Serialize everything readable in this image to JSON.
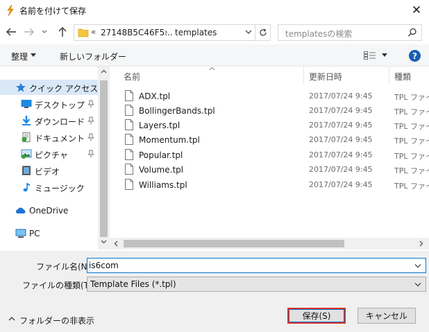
{
  "window": {
    "title": "名前を付けて保存",
    "close_label": "✕"
  },
  "address": {
    "prefix": "«",
    "parent": "27148B5C46F5...",
    "separator": "›",
    "current": "templates"
  },
  "search": {
    "placeholder": "templatesの検索"
  },
  "toolbar": {
    "organize_label": "整理",
    "new_folder_label": "新しいフォルダー"
  },
  "nav": {
    "items": [
      {
        "label": "クイック アクセス",
        "icon": "star-icon",
        "pinned": false
      },
      {
        "label": "デスクトップ",
        "icon": "desktop-icon",
        "pinned": true
      },
      {
        "label": "ダウンロード",
        "icon": "download-icon",
        "pinned": true
      },
      {
        "label": "ドキュメント",
        "icon": "documents-icon",
        "pinned": true
      },
      {
        "label": "ピクチャ",
        "icon": "pictures-icon",
        "pinned": true
      },
      {
        "label": "ビデオ",
        "icon": "video-icon",
        "pinned": false
      },
      {
        "label": "ミュージック",
        "icon": "music-icon",
        "pinned": false
      },
      {
        "label": "OneDrive",
        "icon": "onedrive-icon",
        "pinned": false
      },
      {
        "label": "PC",
        "icon": "pc-icon",
        "pinned": false
      }
    ]
  },
  "columns": {
    "name": "名前",
    "date": "更新日時",
    "type": "種類"
  },
  "files": [
    {
      "name": "ADX.tpl",
      "date": "2017/07/24 9:45",
      "type": "TPL ファイル"
    },
    {
      "name": "BollingerBands.tpl",
      "date": "2017/07/24 9:45",
      "type": "TPL ファイル"
    },
    {
      "name": "Layers.tpl",
      "date": "2017/07/24 9:45",
      "type": "TPL ファイル"
    },
    {
      "name": "Momentum.tpl",
      "date": "2017/07/24 9:45",
      "type": "TPL ファイル"
    },
    {
      "name": "Popular.tpl",
      "date": "2017/07/24 9:45",
      "type": "TPL ファイル"
    },
    {
      "name": "Volume.tpl",
      "date": "2017/07/24 9:45",
      "type": "TPL ファイル"
    },
    {
      "name": "Williams.tpl",
      "date": "2017/07/24 9:45",
      "type": "TPL ファイル"
    }
  ],
  "form": {
    "filename_label": "ファイル名(N):",
    "filename_value": "is6com",
    "filetype_label": "ファイルの種類(T):",
    "filetype_value": "Template Files (*.tpl)"
  },
  "footer": {
    "hide_folders_label": "フォルダーの非表示",
    "save_label": "保存(S)",
    "cancel_label": "キャンセル"
  },
  "colors": {
    "accent": "#0078d7",
    "highlight": "#d93025",
    "selected_bg": "#d9e8f7"
  }
}
